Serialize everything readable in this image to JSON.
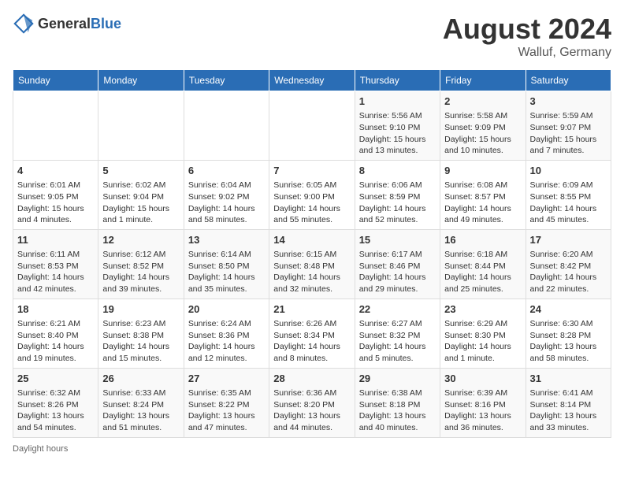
{
  "header": {
    "logo_general": "General",
    "logo_blue": "Blue",
    "month": "August 2024",
    "location": "Walluf, Germany"
  },
  "days_of_week": [
    "Sunday",
    "Monday",
    "Tuesday",
    "Wednesday",
    "Thursday",
    "Friday",
    "Saturday"
  ],
  "footer": {
    "note": "Daylight hours"
  },
  "weeks": [
    [
      {
        "day": "",
        "info": ""
      },
      {
        "day": "",
        "info": ""
      },
      {
        "day": "",
        "info": ""
      },
      {
        "day": "",
        "info": ""
      },
      {
        "day": "1",
        "info": "Sunrise: 5:56 AM\nSunset: 9:10 PM\nDaylight: 15 hours\nand 13 minutes."
      },
      {
        "day": "2",
        "info": "Sunrise: 5:58 AM\nSunset: 9:09 PM\nDaylight: 15 hours\nand 10 minutes."
      },
      {
        "day": "3",
        "info": "Sunrise: 5:59 AM\nSunset: 9:07 PM\nDaylight: 15 hours\nand 7 minutes."
      }
    ],
    [
      {
        "day": "4",
        "info": "Sunrise: 6:01 AM\nSunset: 9:05 PM\nDaylight: 15 hours\nand 4 minutes."
      },
      {
        "day": "5",
        "info": "Sunrise: 6:02 AM\nSunset: 9:04 PM\nDaylight: 15 hours\nand 1 minute."
      },
      {
        "day": "6",
        "info": "Sunrise: 6:04 AM\nSunset: 9:02 PM\nDaylight: 14 hours\nand 58 minutes."
      },
      {
        "day": "7",
        "info": "Sunrise: 6:05 AM\nSunset: 9:00 PM\nDaylight: 14 hours\nand 55 minutes."
      },
      {
        "day": "8",
        "info": "Sunrise: 6:06 AM\nSunset: 8:59 PM\nDaylight: 14 hours\nand 52 minutes."
      },
      {
        "day": "9",
        "info": "Sunrise: 6:08 AM\nSunset: 8:57 PM\nDaylight: 14 hours\nand 49 minutes."
      },
      {
        "day": "10",
        "info": "Sunrise: 6:09 AM\nSunset: 8:55 PM\nDaylight: 14 hours\nand 45 minutes."
      }
    ],
    [
      {
        "day": "11",
        "info": "Sunrise: 6:11 AM\nSunset: 8:53 PM\nDaylight: 14 hours\nand 42 minutes."
      },
      {
        "day": "12",
        "info": "Sunrise: 6:12 AM\nSunset: 8:52 PM\nDaylight: 14 hours\nand 39 minutes."
      },
      {
        "day": "13",
        "info": "Sunrise: 6:14 AM\nSunset: 8:50 PM\nDaylight: 14 hours\nand 35 minutes."
      },
      {
        "day": "14",
        "info": "Sunrise: 6:15 AM\nSunset: 8:48 PM\nDaylight: 14 hours\nand 32 minutes."
      },
      {
        "day": "15",
        "info": "Sunrise: 6:17 AM\nSunset: 8:46 PM\nDaylight: 14 hours\nand 29 minutes."
      },
      {
        "day": "16",
        "info": "Sunrise: 6:18 AM\nSunset: 8:44 PM\nDaylight: 14 hours\nand 25 minutes."
      },
      {
        "day": "17",
        "info": "Sunrise: 6:20 AM\nSunset: 8:42 PM\nDaylight: 14 hours\nand 22 minutes."
      }
    ],
    [
      {
        "day": "18",
        "info": "Sunrise: 6:21 AM\nSunset: 8:40 PM\nDaylight: 14 hours\nand 19 minutes."
      },
      {
        "day": "19",
        "info": "Sunrise: 6:23 AM\nSunset: 8:38 PM\nDaylight: 14 hours\nand 15 minutes."
      },
      {
        "day": "20",
        "info": "Sunrise: 6:24 AM\nSunset: 8:36 PM\nDaylight: 14 hours\nand 12 minutes."
      },
      {
        "day": "21",
        "info": "Sunrise: 6:26 AM\nSunset: 8:34 PM\nDaylight: 14 hours\nand 8 minutes."
      },
      {
        "day": "22",
        "info": "Sunrise: 6:27 AM\nSunset: 8:32 PM\nDaylight: 14 hours\nand 5 minutes."
      },
      {
        "day": "23",
        "info": "Sunrise: 6:29 AM\nSunset: 8:30 PM\nDaylight: 14 hours\nand 1 minute."
      },
      {
        "day": "24",
        "info": "Sunrise: 6:30 AM\nSunset: 8:28 PM\nDaylight: 13 hours\nand 58 minutes."
      }
    ],
    [
      {
        "day": "25",
        "info": "Sunrise: 6:32 AM\nSunset: 8:26 PM\nDaylight: 13 hours\nand 54 minutes."
      },
      {
        "day": "26",
        "info": "Sunrise: 6:33 AM\nSunset: 8:24 PM\nDaylight: 13 hours\nand 51 minutes."
      },
      {
        "day": "27",
        "info": "Sunrise: 6:35 AM\nSunset: 8:22 PM\nDaylight: 13 hours\nand 47 minutes."
      },
      {
        "day": "28",
        "info": "Sunrise: 6:36 AM\nSunset: 8:20 PM\nDaylight: 13 hours\nand 44 minutes."
      },
      {
        "day": "29",
        "info": "Sunrise: 6:38 AM\nSunset: 8:18 PM\nDaylight: 13 hours\nand 40 minutes."
      },
      {
        "day": "30",
        "info": "Sunrise: 6:39 AM\nSunset: 8:16 PM\nDaylight: 13 hours\nand 36 minutes."
      },
      {
        "day": "31",
        "info": "Sunrise: 6:41 AM\nSunset: 8:14 PM\nDaylight: 13 hours\nand 33 minutes."
      }
    ]
  ]
}
